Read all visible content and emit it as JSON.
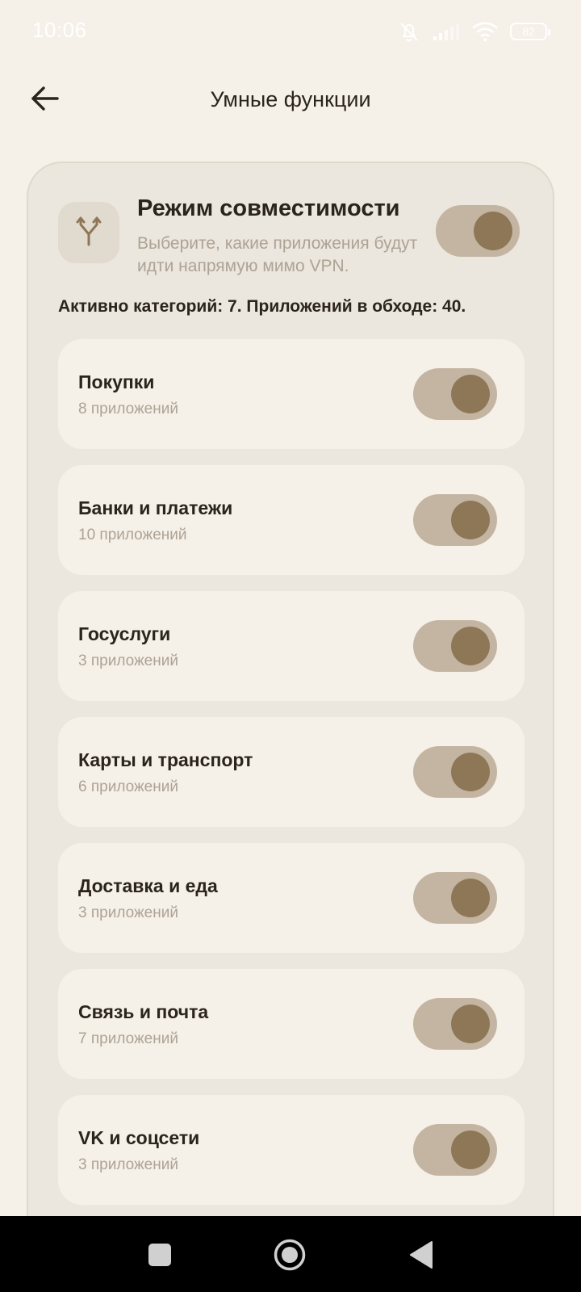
{
  "status_bar": {
    "time": "10:06",
    "battery": "82",
    "icons": [
      "bell-off-icon",
      "signal-icon",
      "wifi-icon",
      "battery-icon"
    ]
  },
  "app_bar": {
    "title": "Умные функции",
    "back_icon": "arrow-left-icon"
  },
  "compat": {
    "icon": "split-arrows-icon",
    "title": "Режим совместимости",
    "description": "Выберите, какие приложения будут идти напрямую мимо VPN.",
    "enabled": true
  },
  "summary": "Активно категорий: 7. Приложений в обходе: 40.",
  "categories": [
    {
      "name": "Покупки",
      "count": "8 приложений",
      "enabled": true
    },
    {
      "name": "Банки и платежи",
      "count": "10 приложений",
      "enabled": true
    },
    {
      "name": "Госуслуги",
      "count": "3 приложений",
      "enabled": true
    },
    {
      "name": "Карты и транспорт",
      "count": "6 приложений",
      "enabled": true
    },
    {
      "name": "Доставка и еда",
      "count": "3 приложений",
      "enabled": true
    },
    {
      "name": "Связь и почта",
      "count": "7 приложений",
      "enabled": true
    },
    {
      "name": "VK и соцсети",
      "count": "3 приложений",
      "enabled": true
    }
  ],
  "nav_bar": {
    "buttons": [
      "recents-square-icon",
      "home-circle-icon",
      "back-triangle-icon"
    ]
  },
  "colors": {
    "background": "#F5F0E8",
    "card": "#EBE6DE",
    "toggle_track": "#C4B5A2",
    "toggle_knob": "#8E7757",
    "text_primary": "#2B241C",
    "text_secondary": "#ADA395"
  }
}
